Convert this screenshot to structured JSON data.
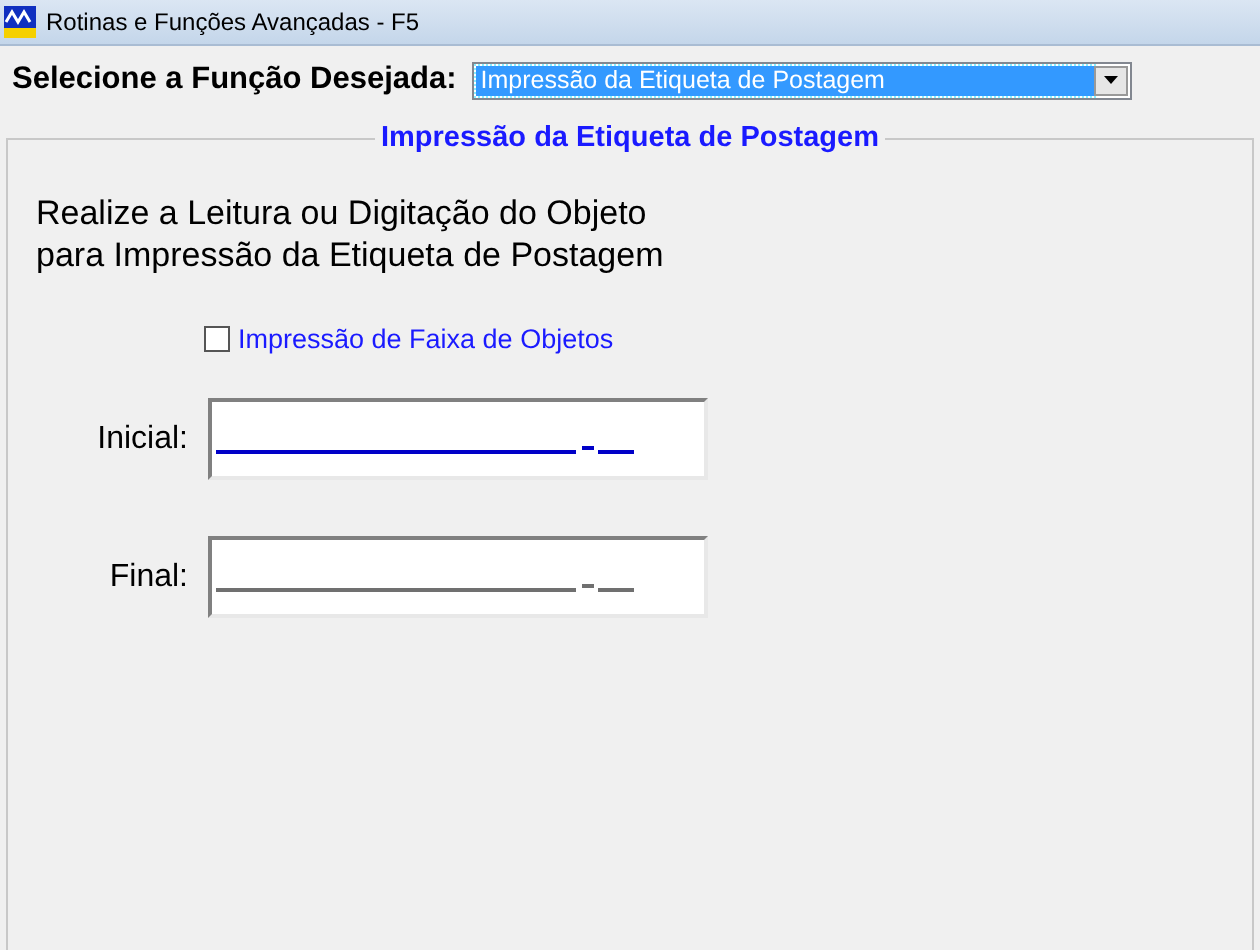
{
  "window": {
    "title": "Rotinas e Funções Avançadas - F5"
  },
  "function_select": {
    "label": "Selecione a Função Desejada:",
    "value": "Impressão da Etiqueta de Postagem"
  },
  "group": {
    "title": "Impressão da Etiqueta de Postagem",
    "instruction_lines": [
      "Realize a Leitura ou Digitação do Objeto",
      "para Impressão da Etiqueta de Postagem"
    ],
    "range_checkbox": {
      "label": "Impressão de Faixa de Objetos",
      "checked": false
    },
    "fields": [
      {
        "label": "Inicial:",
        "focused": true
      },
      {
        "label": "Final:",
        "focused": false
      }
    ]
  }
}
